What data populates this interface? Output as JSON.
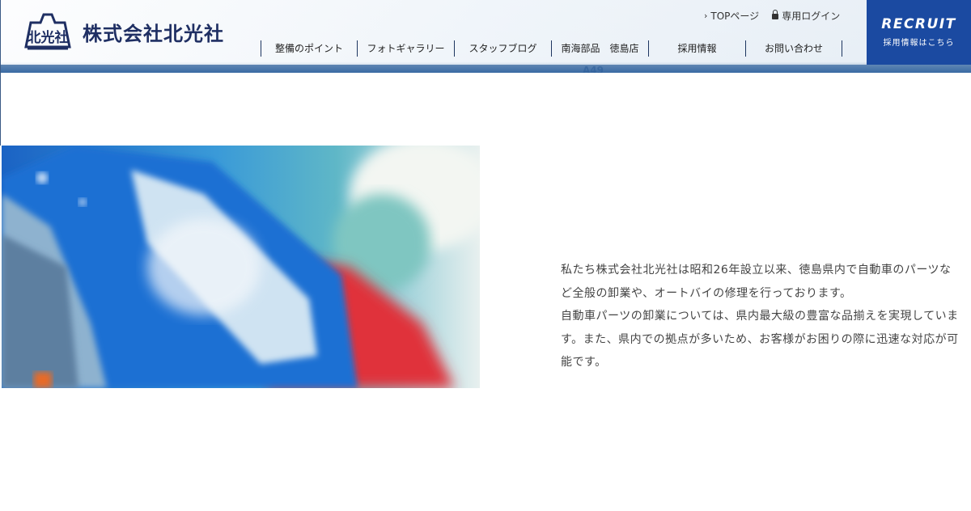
{
  "company": {
    "name": "株式会社北光社",
    "logo_alt": "北光社"
  },
  "top_links": [
    {
      "label": "TOPページ",
      "icon": "chevron-right-icon"
    },
    {
      "label": "専用ログイン",
      "icon": "lock-icon"
    }
  ],
  "nav": [
    {
      "label": "整備のポイント"
    },
    {
      "label": "フォトギャラリー"
    },
    {
      "label": "スタッフブログ"
    },
    {
      "label": "南海部品　徳島店"
    },
    {
      "label": "採用情報"
    },
    {
      "label": "お問い合わせ"
    }
  ],
  "recruit": {
    "title": "RECRUIT",
    "subtitle": "採用情報はこちら"
  },
  "banner_sign": "A49",
  "intro": {
    "lines": [
      "私たち株式会社北光社は昭和26年設立以来、徳島県内で自動車のパーツな",
      "ど全般の卸業や、オートバイの修理を行っております。",
      "自動車パーツの卸業については、県内最大級の豊富な品揃えを実現していま",
      "す。また、県内での拠点が多いため、お客様がお困りの際に迅速な対応が可",
      "能です。"
    ]
  },
  "colors": {
    "brand_navy": "#1f2f63",
    "recruit_blue": "#1b4aa1",
    "nav_divider": "#1d3560"
  }
}
